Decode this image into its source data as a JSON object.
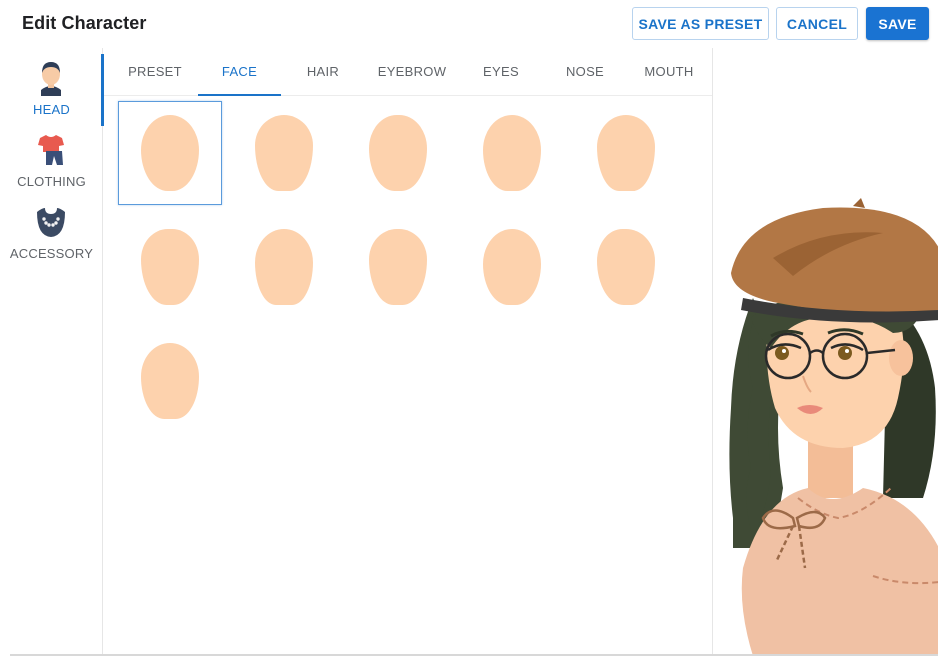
{
  "header": {
    "title": "Edit Character",
    "buttons": {
      "save_as_preset": "SAVE AS PRESET",
      "cancel": "CANCEL",
      "save": "SAVE"
    }
  },
  "categories": [
    {
      "label": "HEAD",
      "icon": "head-icon",
      "active": true
    },
    {
      "label": "CLOTHING",
      "icon": "clothing-icon",
      "active": false
    },
    {
      "label": "ACCESSORY",
      "icon": "necklace-icon",
      "active": false
    }
  ],
  "tabs": [
    {
      "label": "PRESET",
      "active": false
    },
    {
      "label": "FACE",
      "active": true
    },
    {
      "label": "HAIR",
      "active": false
    },
    {
      "label": "EYEBROW",
      "active": false
    },
    {
      "label": "EYES",
      "active": false
    },
    {
      "label": "NOSE",
      "active": false
    },
    {
      "label": "MOUTH",
      "active": false
    }
  ],
  "face_options": {
    "count": 11,
    "selected_index": 0,
    "skin_color": "#fdd2ad"
  },
  "colors": {
    "accent": "#1a73c9",
    "skin": "#fdd2ad",
    "hair": "#3f4a35",
    "beret": "#b27745",
    "shirt": "#f0c1a4"
  }
}
